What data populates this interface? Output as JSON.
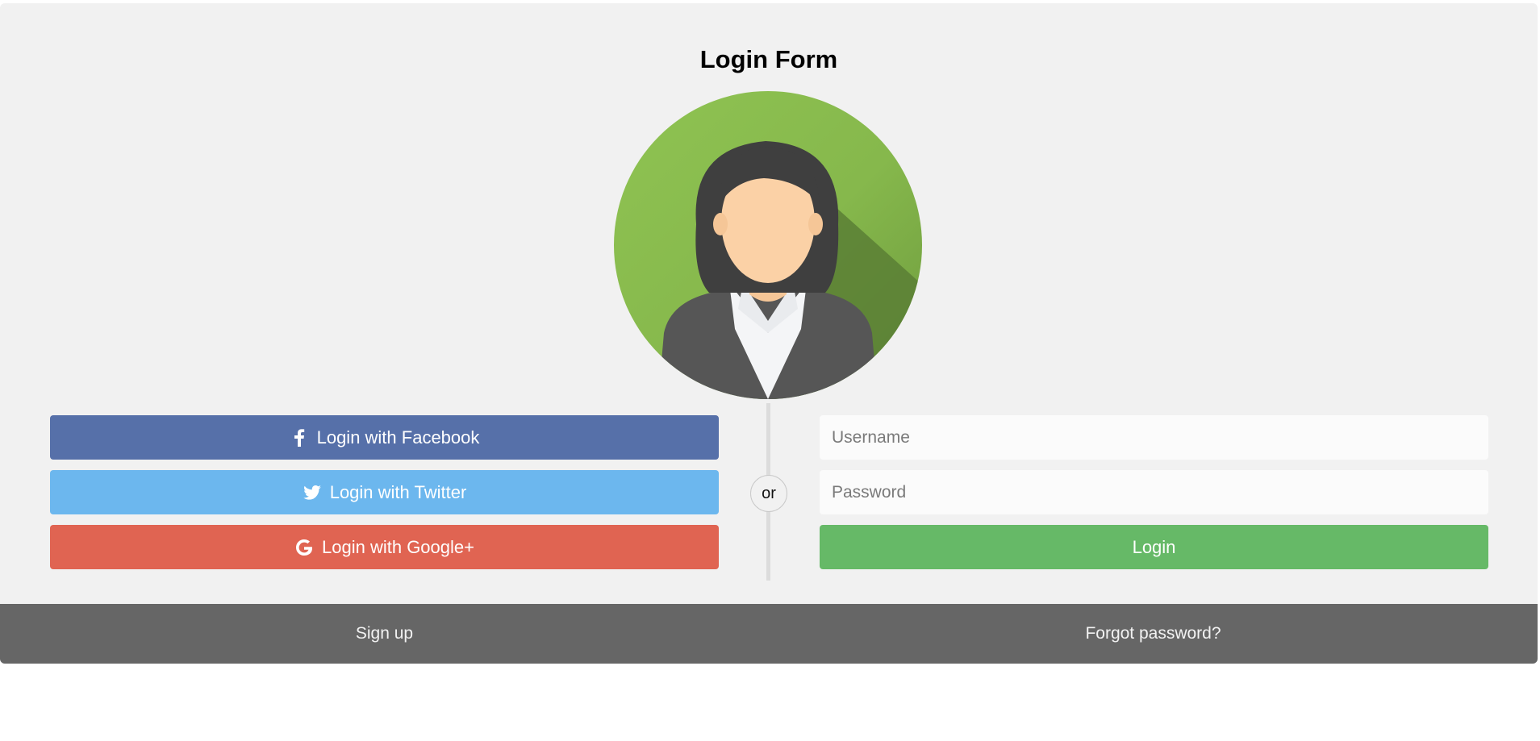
{
  "form": {
    "title": "Login Form"
  },
  "social": {
    "facebook_label": "Login with Facebook",
    "twitter_label": "Login with Twitter",
    "google_label": "Login with Google+"
  },
  "divider": {
    "or_label": "or"
  },
  "fields": {
    "username_placeholder": "Username",
    "password_placeholder": "Password"
  },
  "actions": {
    "login_label": "Login"
  },
  "footer": {
    "signup_label": "Sign up",
    "forgot_label": "Forgot password?"
  },
  "colors": {
    "facebook": "#5670a9",
    "twitter": "#6cb7ee",
    "google": "#e06452",
    "login": "#66b967",
    "footer": "#666666",
    "panel": "#f1f1f1"
  },
  "icons": {
    "facebook": "facebook-f-icon",
    "twitter": "twitter-bird-icon",
    "google": "google-g-icon"
  }
}
